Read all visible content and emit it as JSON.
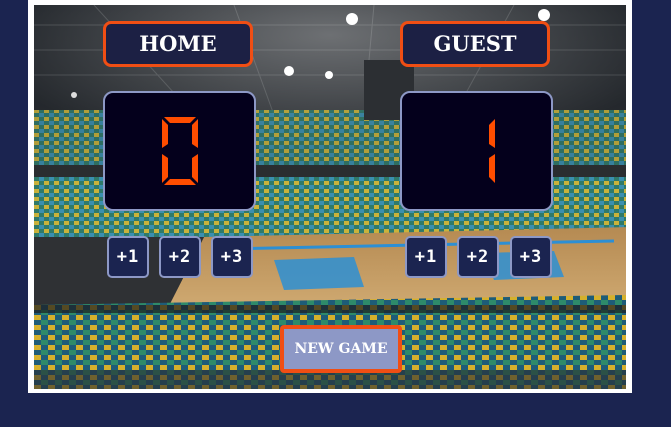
{
  "home": {
    "label": "HOME",
    "score": 0,
    "buttons": [
      "+1",
      "+2",
      "+3"
    ]
  },
  "guest": {
    "label": "GUEST",
    "score": 1,
    "buttons": [
      "+1",
      "+2",
      "+3"
    ]
  },
  "new_game_label": "NEW GAME",
  "colors": {
    "page_background": "#1b2450",
    "accent": "#f04e14",
    "score_digit": "#ff4d00",
    "score_background": "#04001c",
    "button_border": "#8d98c6"
  },
  "background_image": "basketball-arena-photo"
}
